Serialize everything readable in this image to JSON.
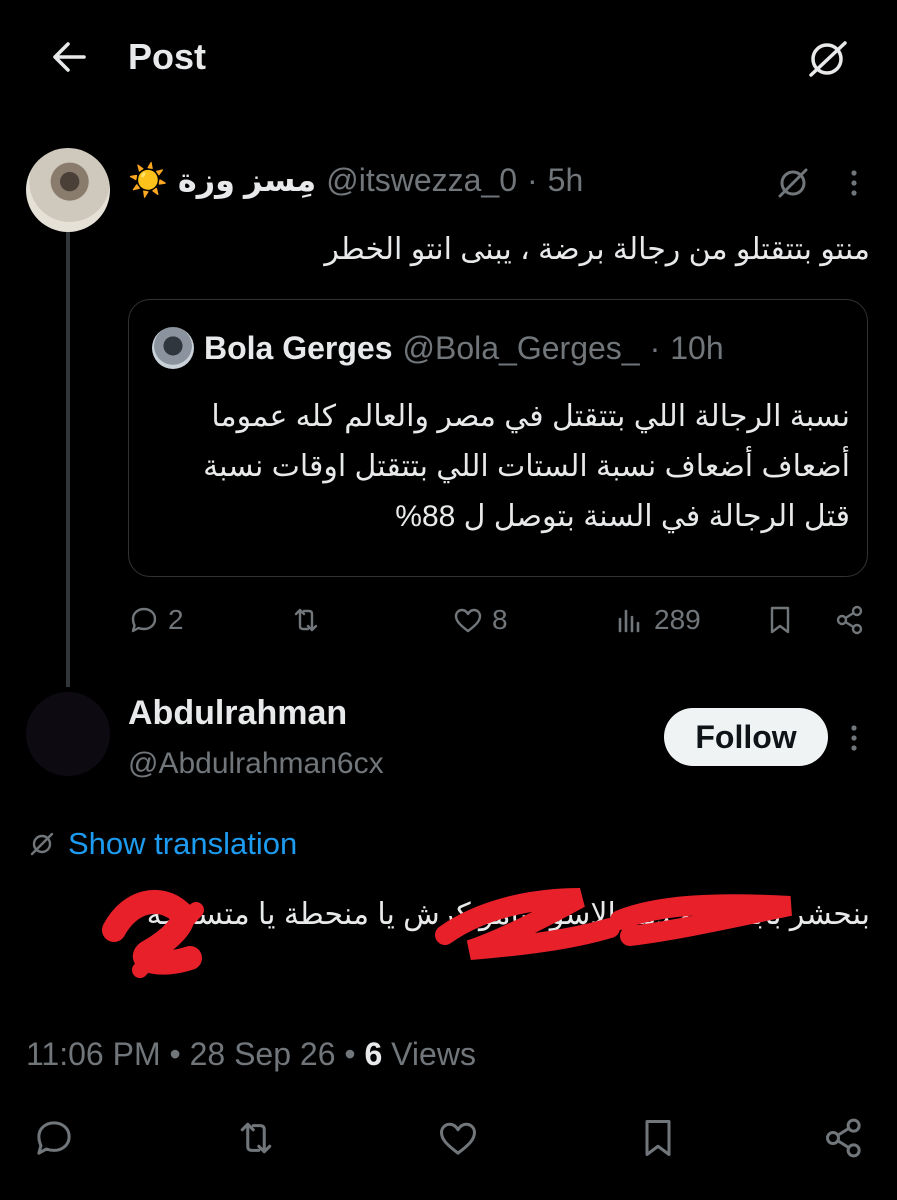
{
  "header": {
    "title": "Post"
  },
  "parent_tweet": {
    "display_name": "مِسز وزة",
    "emoji": "☀️",
    "handle": "@itswezza_0",
    "time": "5h",
    "text": "منتو بتتقتلو من رجالة برضة ، يبنى انتو الخطر",
    "quote": {
      "display_name": "Bola Gerges",
      "handle": "@Bola_Gerges_",
      "time": "10h",
      "text": "نسبة الرجالة اللي بتتقتل في مصر والعالم كله عموما أضعاف أضعاف نسبة الستات اللي بتتقتل اوقات نسبة قتل الرجالة في السنة بتوصل ل 88%"
    },
    "actions": {
      "replies": "2",
      "likes": "8",
      "views": "289"
    }
  },
  "reply": {
    "display_name": "Abdulrahman",
    "handle": "@Abdulrahman6cx",
    "follow_label": "Follow",
    "translate_label": "Show translation",
    "text": "بنحشر بابا في خدمة الاسود يامو كرش يا منحطة يا متسرحة",
    "timestamp_prefix": "11:06 PM • 28 Sep 26 • ",
    "views_count": "6",
    "views_label": " Views"
  },
  "colors": {
    "background": "#000000",
    "text_primary": "#e7e9ea",
    "text_muted": "#71767b",
    "link": "#1d9bf0",
    "redaction": "#e8202a"
  },
  "icons": [
    "back-arrow-icon",
    "grok-icon",
    "more-icon",
    "reply-icon",
    "retweet-icon",
    "like-icon",
    "views-icon",
    "bookmark-icon",
    "share-icon"
  ]
}
